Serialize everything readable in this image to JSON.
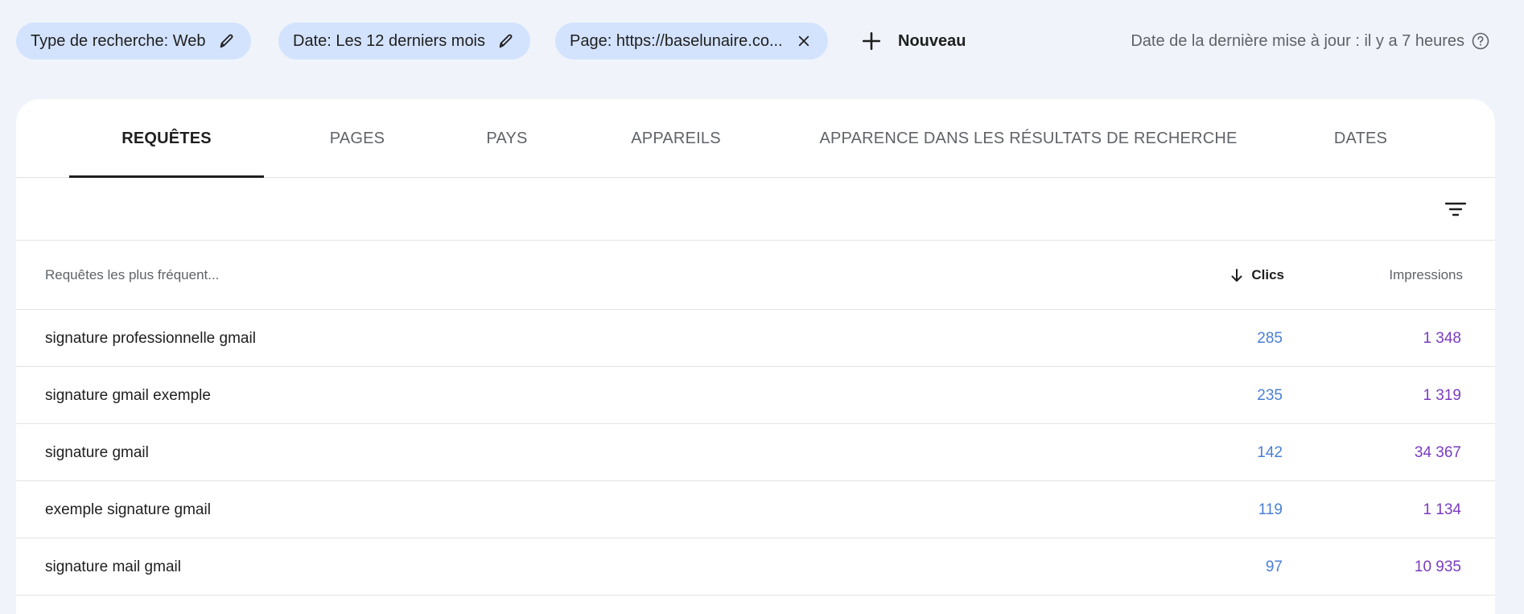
{
  "filters": {
    "search_type": "Type de recherche: Web",
    "date": "Date: Les 12 derniers mois",
    "page": "Page: https://baselunaire.co...",
    "new_label": "Nouveau",
    "last_update": "Date de la dernière mise à jour : il y a 7 heures"
  },
  "tabs": [
    {
      "label": "REQUÊTES",
      "active": true
    },
    {
      "label": "PAGES"
    },
    {
      "label": "PAYS"
    },
    {
      "label": "APPAREILS"
    },
    {
      "label": "APPARENCE DANS LES RÉSULTATS DE RECHERCHE"
    },
    {
      "label": "DATES"
    }
  ],
  "table": {
    "header": {
      "query": "Requêtes les plus fréquent...",
      "clicks": "Clics",
      "impressions": "Impressions"
    },
    "rows": [
      {
        "query": "signature professionnelle gmail",
        "clicks": "285",
        "impressions": "1 348"
      },
      {
        "query": "signature gmail exemple",
        "clicks": "235",
        "impressions": "1 319"
      },
      {
        "query": "signature gmail",
        "clicks": "142",
        "impressions": "34 367"
      },
      {
        "query": "exemple signature gmail",
        "clicks": "119",
        "impressions": "1 134"
      },
      {
        "query": "signature mail gmail",
        "clicks": "97",
        "impressions": "10 935"
      }
    ]
  },
  "colors": {
    "chip_bg": "#d3e3fd",
    "clicks": "#4a7fd4",
    "impressions": "#7a3bbf"
  },
  "icons": {
    "edit": "pencil-icon",
    "remove": "close-icon",
    "add": "plus-icon",
    "help": "help-circle-icon",
    "filter": "filter-icon",
    "sort": "arrow-down-icon"
  }
}
